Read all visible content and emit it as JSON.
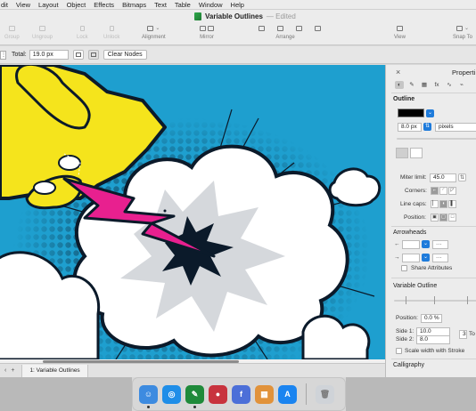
{
  "menubar": [
    "dit",
    "View",
    "Layout",
    "Object",
    "Effects",
    "Bitmaps",
    "Text",
    "Table",
    "Window",
    "Help"
  ],
  "window": {
    "title": "Variable Outlines",
    "status": "— Edited"
  },
  "toolbar": {
    "group": "Group",
    "ungroup": "Ungroup",
    "lock": "Lock",
    "unlock": "Unlock",
    "alignment": "Alignment",
    "mirror": "Mirror",
    "arrange": "Arrange",
    "view": "View",
    "snap_to": "Snap To"
  },
  "context_bar": {
    "total_label": "Total:",
    "total_value": "19.0 px",
    "clear_nodes": "Clear Nodes"
  },
  "tabs": {
    "prev": "‹",
    "add": "+",
    "current": "1: Variable Outlines"
  },
  "panel": {
    "title": "Properti",
    "outline_heading": "Outline",
    "outline_color": "#000000",
    "width_value": "8.0 px",
    "width_unit": "pixels",
    "miter_label": "Miter limit:",
    "miter_value": "45.0",
    "corners_label": "Corners:",
    "line_caps_label": "Line caps:",
    "position_label": "Position:",
    "arrowheads_heading": "Arrowheads",
    "share_attributes": "Share Attributes",
    "variable_outline_heading": "Variable Outline",
    "vo_position_label": "Position:",
    "vo_position_value": "0.0 %",
    "side1_label": "Side 1:",
    "side1_value": "10.0",
    "side2_label": "Side 2:",
    "side2_value": "8.0",
    "link_value": "3",
    "to_label": "To",
    "scale_label": "Scale width with Stroke",
    "calligraphy_heading": "Calligraphy"
  },
  "dock": {
    "apps": [
      {
        "name": "finder",
        "glyph": "☺",
        "color": "#3d8be0"
      },
      {
        "name": "safari",
        "glyph": "◎",
        "color": "#1f8ee8"
      },
      {
        "name": "vectornator",
        "glyph": "✎",
        "color": "#1f8a3a"
      },
      {
        "name": "screen-recorder",
        "glyph": "●",
        "color": "#c8333e"
      },
      {
        "name": "font-app",
        "glyph": "f",
        "color": "#4c6fd8"
      },
      {
        "name": "launchpad",
        "glyph": "▦",
        "color": "#e1923a"
      },
      {
        "name": "app-store",
        "glyph": "A",
        "color": "#1a84f0"
      }
    ],
    "trash": "trash"
  },
  "colors": {
    "canvas_bg": "#1e9fcf",
    "lightning": "#e8208f",
    "hand": "#f5e41c",
    "accent": "#1e7bdb"
  }
}
